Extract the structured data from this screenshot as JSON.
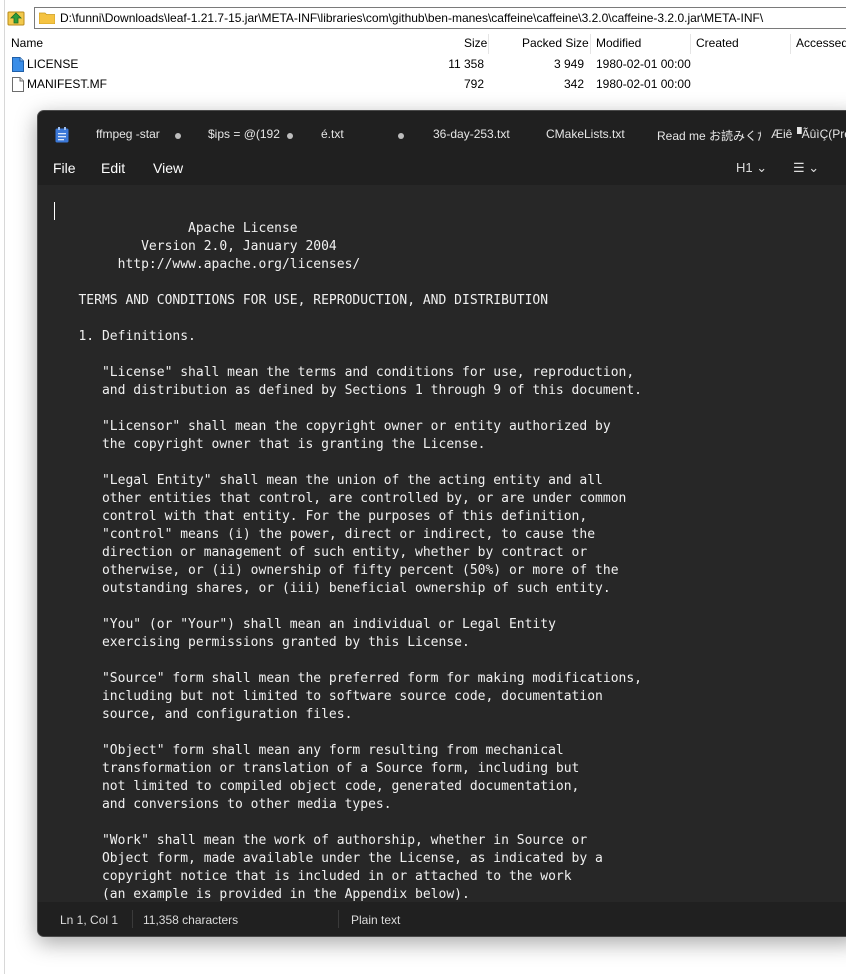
{
  "file_manager": {
    "address": "D:\\funni\\Downloads\\leaf-1.21.7-15.jar\\META-INF\\libraries\\com\\github\\ben-manes\\caffeine\\caffeine\\3.2.0\\caffeine-3.2.0.jar\\META-INF\\",
    "columns": {
      "name": "Name",
      "size": "Size",
      "packed": "Packed Size",
      "modified": "Modified",
      "created": "Created",
      "accessed": "Accessed"
    },
    "files": [
      {
        "name": "LICENSE",
        "size": "11 358",
        "packed": "3 949",
        "modified": "1980-02-01 00:00",
        "icon": "text-file-icon"
      },
      {
        "name": "MANIFEST.MF",
        "size": "792",
        "packed": "342",
        "modified": "1980-02-01 00:00",
        "icon": "file-icon"
      }
    ]
  },
  "notepad": {
    "tabs": [
      {
        "label": "ffmpeg -star",
        "modified": true
      },
      {
        "label": "$ips = @(192",
        "modified": true
      },
      {
        "label": "é.txt",
        "modified": true
      },
      {
        "label": "36-day-253.txt",
        "modified": false
      },
      {
        "label": "CMakeLists.txt",
        "modified": false
      },
      {
        "label": "Read me お読みくだ",
        "modified": false
      },
      {
        "label": "Æiê▝ÃûìÇ(Prec",
        "modified": false
      }
    ],
    "menu": {
      "file": "File",
      "edit": "Edit",
      "view": "View"
    },
    "toolbar": {
      "heading": "H1 ⌄",
      "list": "☰ ⌄"
    },
    "content": "                 Apache License\n           Version 2.0, January 2004\n        http://www.apache.org/licenses/\n\n   TERMS AND CONDITIONS FOR USE, REPRODUCTION, AND DISTRIBUTION\n\n   1. Definitions.\n\n      \"License\" shall mean the terms and conditions for use, reproduction,\n      and distribution as defined by Sections 1 through 9 of this document.\n\n      \"Licensor\" shall mean the copyright owner or entity authorized by\n      the copyright owner that is granting the License.\n\n      \"Legal Entity\" shall mean the union of the acting entity and all\n      other entities that control, are controlled by, or are under common\n      control with that entity. For the purposes of this definition,\n      \"control\" means (i) the power, direct or indirect, to cause the\n      direction or management of such entity, whether by contract or\n      otherwise, or (ii) ownership of fifty percent (50%) or more of the\n      outstanding shares, or (iii) beneficial ownership of such entity.\n\n      \"You\" (or \"Your\") shall mean an individual or Legal Entity\n      exercising permissions granted by this License.\n\n      \"Source\" form shall mean the preferred form for making modifications,\n      including but not limited to software source code, documentation\n      source, and configuration files.\n\n      \"Object\" form shall mean any form resulting from mechanical\n      transformation or translation of a Source form, including but\n      not limited to compiled object code, generated documentation,\n      and conversions to other media types.\n\n      \"Work\" shall mean the work of authorship, whether in Source or\n      Object form, made available under the License, as indicated by a\n      copyright notice that is included in or attached to the work\n      (an example is provided in the Appendix below).",
    "status": {
      "position": "Ln 1, Col 1",
      "characters": "11,358 characters",
      "format": "Plain text"
    }
  },
  "colors": {
    "accent": "#3b78d8",
    "editor_bg": "#272727",
    "chrome_bg": "#202020"
  }
}
